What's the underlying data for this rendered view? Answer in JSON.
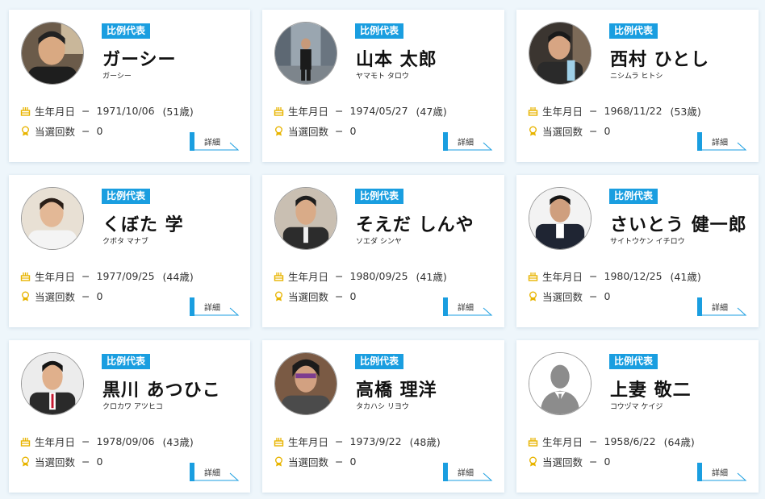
{
  "badge_label": "比例代表",
  "birth_label": "生年月日",
  "elect_label": "当選回数",
  "dash": "−",
  "detail_label": "詳細",
  "colors": {
    "accent": "#1a9ee0",
    "icon": "#e8b400"
  },
  "icons": {
    "birth": "cake-icon",
    "elect": "medal-icon",
    "detail": "arrow-line-icon"
  },
  "candidates": [
    {
      "name": "ガーシー",
      "kana": "ガーシー",
      "birth": "1971/10/06",
      "age": "(51歳)",
      "elected": "0"
    },
    {
      "name": "山本 太郎",
      "kana": "ヤマモト タロウ",
      "birth": "1974/05/27",
      "age": "(47歳)",
      "elected": "0"
    },
    {
      "name": "西村 ひとし",
      "kana": "ニシムラ ヒトシ",
      "birth": "1968/11/22",
      "age": "(53歳)",
      "elected": "0"
    },
    {
      "name": "くぼた 学",
      "kana": "クボタ マナブ",
      "birth": "1977/09/25",
      "age": "(44歳)",
      "elected": "0"
    },
    {
      "name": "そえだ しんや",
      "kana": "ソエダ シンヤ",
      "birth": "1980/09/25",
      "age": "(41歳)",
      "elected": "0"
    },
    {
      "name": "さいとう 健一郎",
      "kana": "サイトウケン イチロウ",
      "birth": "1980/12/25",
      "age": "(41歳)",
      "elected": "0"
    },
    {
      "name": "黒川 あつひこ",
      "kana": "クロカワ アツヒコ",
      "birth": "1978/09/06",
      "age": "(43歳)",
      "elected": "0"
    },
    {
      "name": "高橋 理洋",
      "kana": "タカハシ リヨウ",
      "birth": "1973/9/22",
      "age": "(48歳)",
      "elected": "0"
    },
    {
      "name": "上妻 敬二",
      "kana": "コウヅマ ケイジ",
      "birth": "1958/6/22",
      "age": "(64歳)",
      "elected": "0"
    }
  ]
}
